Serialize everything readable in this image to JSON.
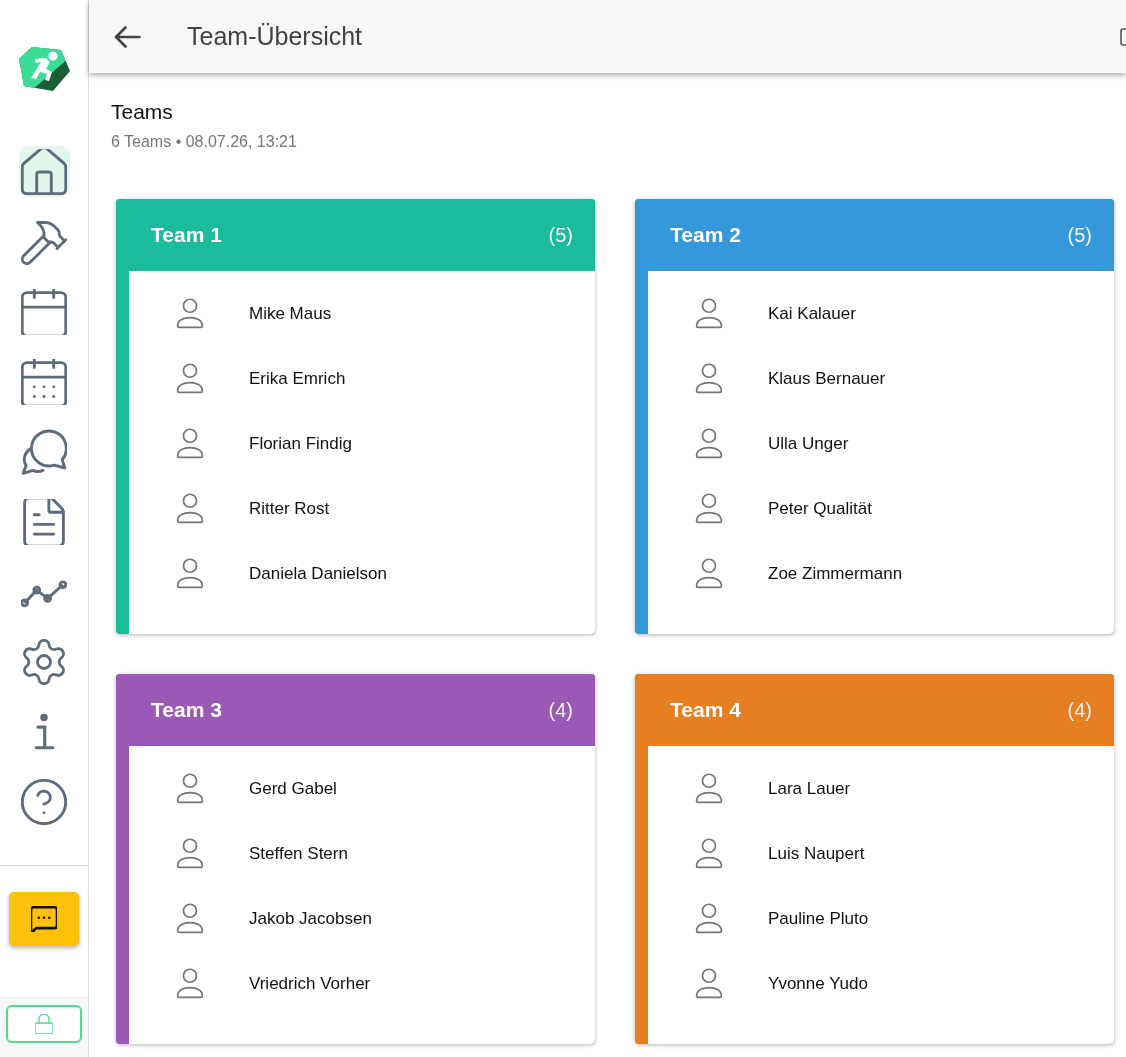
{
  "sidebar": {
    "items": [
      {
        "kind": "home",
        "selected": true
      },
      {
        "kind": "hammer",
        "selected": false
      },
      {
        "kind": "calendar",
        "selected": false
      },
      {
        "kind": "calendar-dots",
        "selected": false
      },
      {
        "kind": "chat",
        "selected": false
      },
      {
        "kind": "document",
        "selected": false
      },
      {
        "kind": "chart",
        "selected": false
      },
      {
        "kind": "settings",
        "selected": false
      },
      {
        "kind": "info",
        "selected": false
      },
      {
        "kind": "help",
        "selected": false
      }
    ]
  },
  "header": {
    "title": "Team-Übersicht"
  },
  "section": {
    "title": "Teams",
    "subtitle": "6 Teams • 08.07.26, 13:21"
  },
  "teams": [
    {
      "name": "Team 1",
      "count": "(5)",
      "color": "#1abc9c",
      "members": [
        "Mike Maus",
        "Erika Emrich",
        "Florian Findig",
        "Ritter Rost",
        "Daniela Danielson"
      ]
    },
    {
      "name": "Team 2",
      "count": "(5)",
      "color": "#3498db",
      "members": [
        "Kai Kalauer",
        "Klaus Bernauer",
        "Ulla Unger",
        "Peter Qualität",
        "Zoe Zimmermann"
      ]
    },
    {
      "name": "Team 3",
      "count": "(4)",
      "color": "#9b59b6",
      "members": [
        "Gerd Gabel",
        "Steffen Stern",
        "Jakob Jacobsen",
        "Vriedrich Vorher"
      ]
    },
    {
      "name": "Team 4",
      "count": "(4)",
      "color": "#e67e22",
      "members": [
        "Lara Lauer",
        "Luis Naupert",
        "Pauline Pluto",
        "Yvonne Yudo"
      ]
    }
  ]
}
